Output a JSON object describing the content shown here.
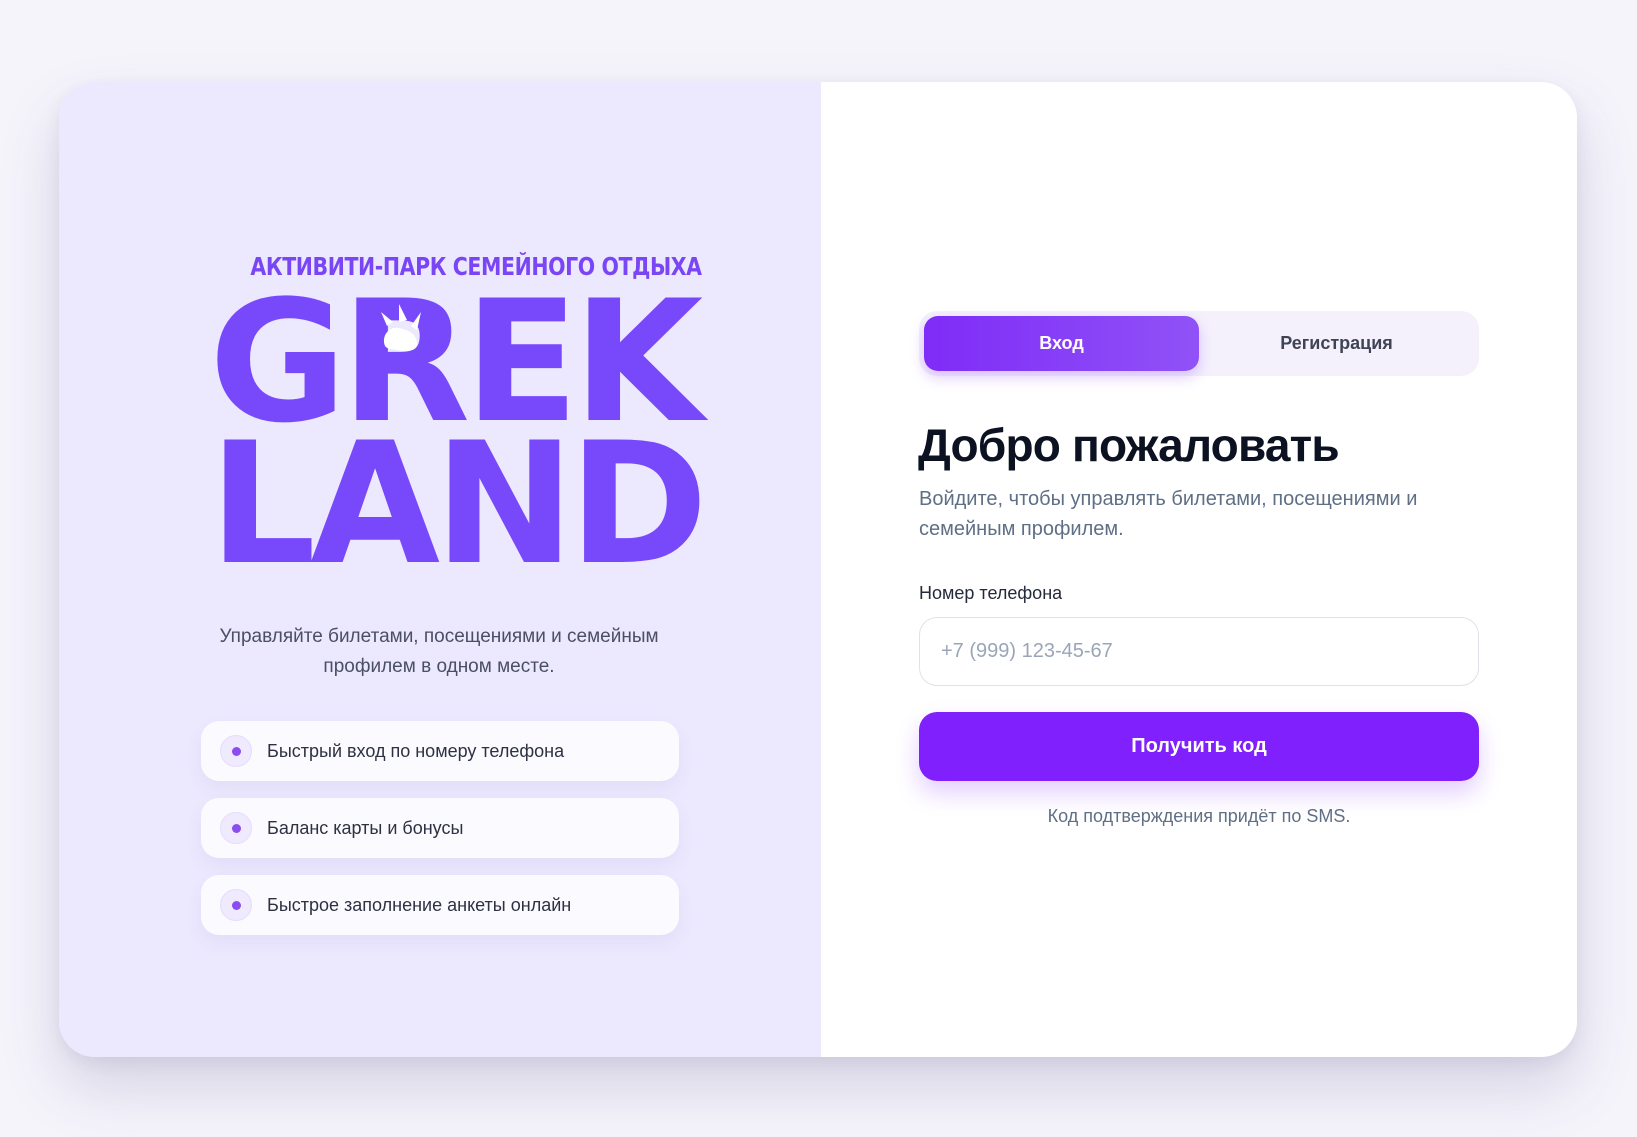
{
  "brand": {
    "tagline": "АКТИВИТИ-ПАРК СЕМЕЙНОГО ОТДЫХА",
    "name_line1": "GREK",
    "name_line2": "LAND",
    "color": "#7848fb",
    "icon": "paw-icon"
  },
  "left_panel": {
    "description": "Управляйте билетами, посещениями и семейным профилем в одном месте.",
    "features": [
      {
        "label": "Быстрый вход по номеру телефона"
      },
      {
        "label": "Баланс карты и бонусы"
      },
      {
        "label": "Быстрое заполнение анкеты онлайн"
      }
    ]
  },
  "auth": {
    "tabs": [
      {
        "label": "Вход",
        "active": true
      },
      {
        "label": "Регистрация",
        "active": false
      }
    ],
    "title": "Добро пожаловать",
    "subtitle": "Войдите, чтобы управлять билетами, посещениями и семейным профилем.",
    "phone_label": "Номер телефона",
    "phone_placeholder": "+7 (999) 123-45-67",
    "phone_value": "",
    "submit_label": "Получить код",
    "sms_note": "Код подтверждения придёт по SMS.",
    "accent": "#8020fd"
  }
}
